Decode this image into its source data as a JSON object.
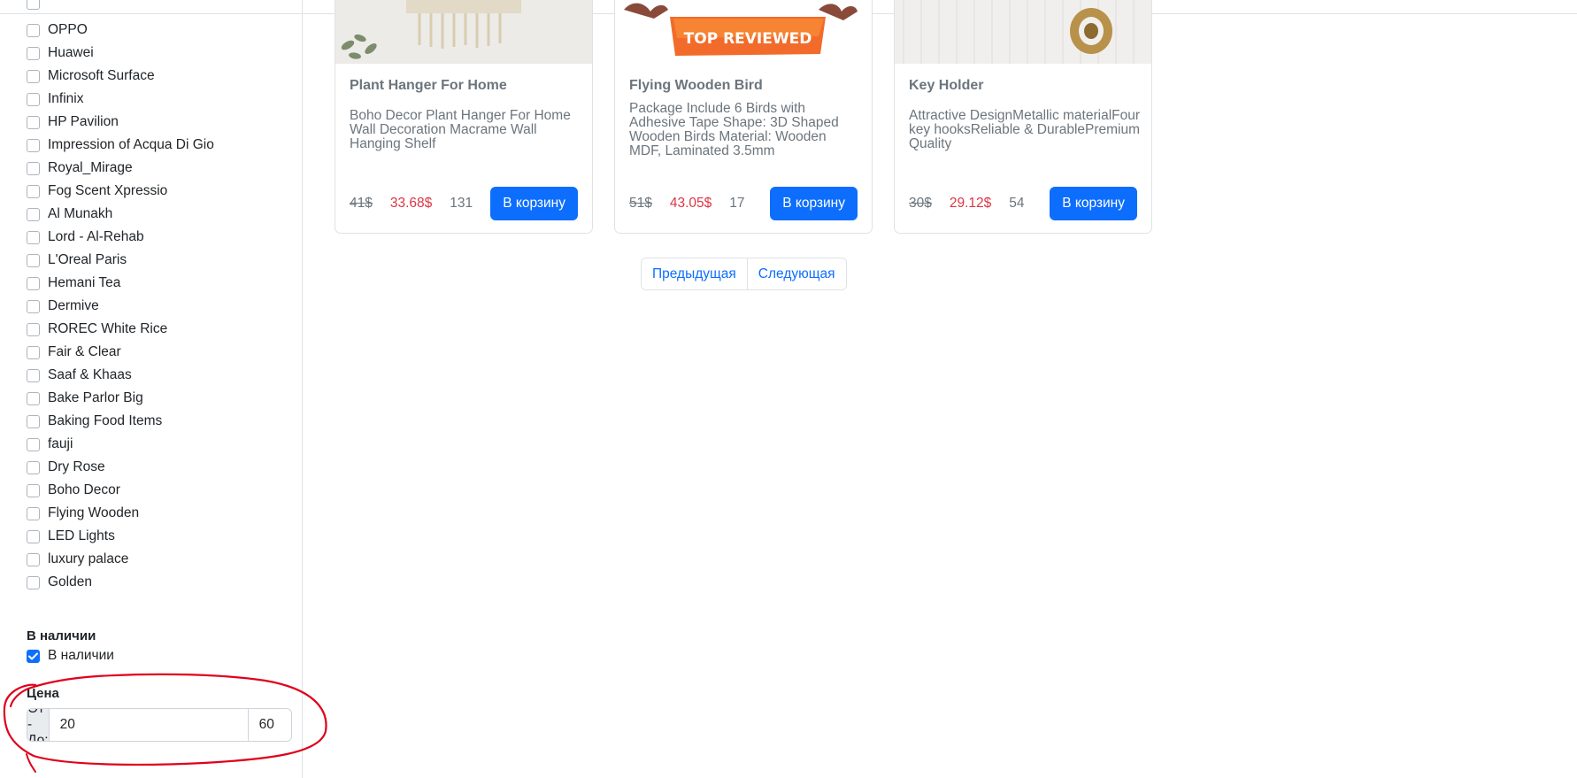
{
  "sidebar": {
    "brands": [
      {
        "label": "OPPO",
        "checked": false
      },
      {
        "label": "Huawei",
        "checked": false
      },
      {
        "label": "Microsoft Surface",
        "checked": false
      },
      {
        "label": "Infinix",
        "checked": false
      },
      {
        "label": "HP Pavilion",
        "checked": false
      },
      {
        "label": "Impression of Acqua Di Gio",
        "checked": false
      },
      {
        "label": "Royal_Mirage",
        "checked": false
      },
      {
        "label": "Fog Scent Xpressio",
        "checked": false
      },
      {
        "label": "Al Munakh",
        "checked": false
      },
      {
        "label": "Lord - Al-Rehab",
        "checked": false
      },
      {
        "label": "L'Oreal Paris",
        "checked": false
      },
      {
        "label": "Hemani Tea",
        "checked": false
      },
      {
        "label": "Dermive",
        "checked": false
      },
      {
        "label": "ROREC White Rice",
        "checked": false
      },
      {
        "label": "Fair & Clear",
        "checked": false
      },
      {
        "label": "Saaf & Khaas",
        "checked": false
      },
      {
        "label": "Bake Parlor Big",
        "checked": false
      },
      {
        "label": "Baking Food Items",
        "checked": false
      },
      {
        "label": "fauji",
        "checked": false
      },
      {
        "label": "Dry Rose",
        "checked": false
      },
      {
        "label": "Boho Decor",
        "checked": false
      },
      {
        "label": "Flying Wooden",
        "checked": false
      },
      {
        "label": "LED Lights",
        "checked": false
      },
      {
        "label": "luxury palace",
        "checked": false
      },
      {
        "label": "Golden",
        "checked": false
      }
    ],
    "in_stock": {
      "title": "В наличии",
      "label": "В наличии",
      "checked": true
    },
    "price": {
      "title": "Цена",
      "prefix": "От - До:",
      "from": "20",
      "to": "60"
    }
  },
  "products": [
    {
      "title": "Plant Hanger For Home",
      "description": "Boho Decor Plant Hanger For Home Wall Decoration Macrame Wall Hanging Shelf",
      "old_price": "41$",
      "price": "33.68$",
      "stock": "131",
      "button": "В корзину"
    },
    {
      "title": "Flying Wooden Bird",
      "description": "Package Include 6 Birds with Adhesive Tape Shape: 3D Shaped Wooden Birds Material: Wooden MDF, Laminated 3.5mm",
      "old_price": "51$",
      "price": "43.05$",
      "stock": "17",
      "button": "В корзину",
      "image_badge": "TOP REVIEWED"
    },
    {
      "title": "Key Holder",
      "description": "Attractive DesignMetallic materialFour key hooksReliable & DurablePremium Quality",
      "old_price": "30$",
      "price": "29.12$",
      "stock": "54",
      "button": "В корзину"
    }
  ],
  "pagination": {
    "prev": "Предыдущая",
    "next": "Следующая"
  },
  "colors": {
    "primary": "#0d6efd",
    "sale": "#dc3545",
    "muted": "#6c757d",
    "annotation": "#e0001b"
  }
}
